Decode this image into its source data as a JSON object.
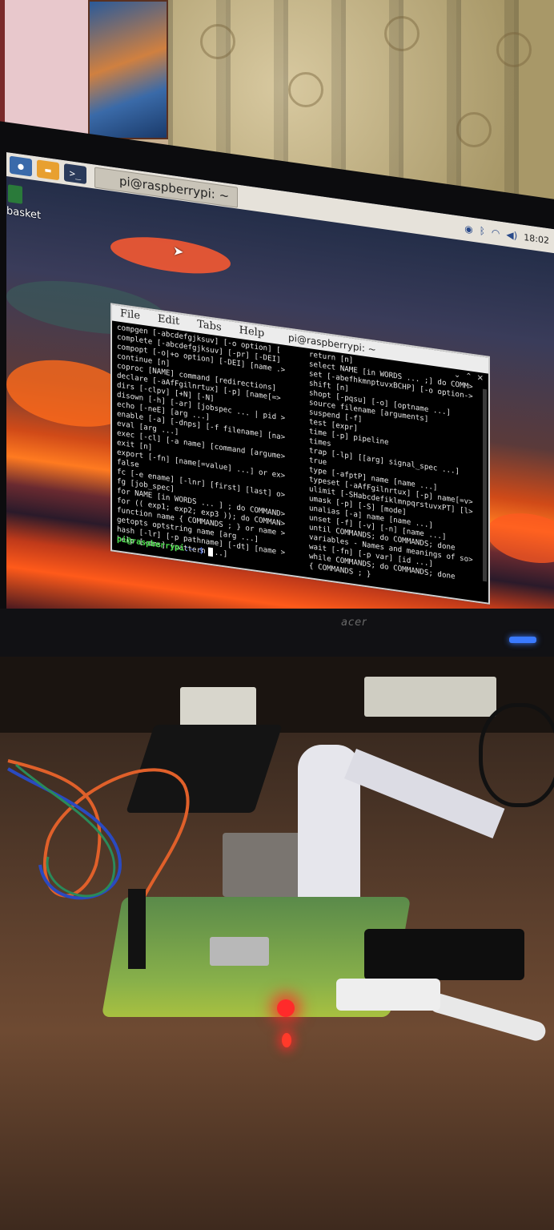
{
  "desktop": {
    "taskbar_task_label": "pi@raspberrypi: ~",
    "icon_label": "basket",
    "tray_time": "18:02"
  },
  "terminal": {
    "menu": [
      "File",
      "Edit",
      "Tabs",
      "Help"
    ],
    "title": "pi@raspberrypi: ~",
    "left_column": [
      "compgen [-abcdefgjksuv] [-o option] [",
      "complete [-abcdefgjksuv] [-pr] [-DEI]",
      "compopt [-o|+o option] [-DEI] [name .>",
      "continue [n]",
      "coproc [NAME] command [redirections]",
      "declare [-aAfFgilnrtux] [-p] [name[=>",
      "dirs [-clpv] [+N] [-N]",
      "disown [-h] [-ar] [jobspec ... | pid >",
      "echo [-neE] [arg ...]",
      "enable [-a] [-dnps] [-f filename] [na>",
      "eval [arg ...]",
      "exec [-cl] [-a name] [command [argume>",
      "exit [n]",
      "export [-fn] [name[=value] ...] or ex>",
      "false",
      "fc [-e ename] [-lnr] [first] [last] o>",
      "fg [job_spec]",
      "for NAME [in WORDS ... ] ; do COMMAND>",
      "for (( exp1; exp2; exp3 )); do COMMAN>",
      "function name { COMMANDS ; } or name >",
      "getopts optstring name [arg ...]",
      "hash [-lr] [-p pathname] [-dt] [name >",
      "help [-dms] [pattern ...]"
    ],
    "right_column": [
      "return [n]",
      "select NAME [in WORDS ... ;] do COMM>",
      "set [-abefhkmnptuvxBCHP] [-o option->",
      "shift [n]",
      "shopt [-pqsu] [-o] [optname ...]",
      "source filename [arguments]",
      "suspend [-f]",
      "test [expr]",
      "time [-p] pipeline",
      "times",
      "trap [-lp] [[arg] signal_spec ...]",
      "true",
      "type [-afptP] name [name ...]",
      "typeset [-aAfFgilnrtux] [-p] name[=v>",
      "ulimit [-SHabcdefiklmnpqrstuvxPT] [l>",
      "umask [-p] [-S] [mode]",
      "unalias [-a] name [name ...]",
      "unset [-f] [-v] [-n] [name ...]",
      "until COMMANDS; do COMMANDS; done",
      "variables - Names and meanings of so>",
      "wait [-fn] [-p var] [id ...]",
      "while COMMANDS; do COMMANDS; done",
      "{ COMMANDS ; }"
    ],
    "prompt_user": "pi@raspberrypi",
    "prompt_path": ":~ $ "
  },
  "monitor": {
    "brand": "acer"
  },
  "icons": {
    "menu": "raspberry-menu-icon",
    "files": "file-manager-icon",
    "terminal": "terminal-icon",
    "trash": "trash-icon"
  },
  "colors": {
    "prompt_user": "#4ce04c",
    "prompt_path": "#6a8aff",
    "power_led": "#3a7aff",
    "board_led": "#ff2a2a"
  }
}
